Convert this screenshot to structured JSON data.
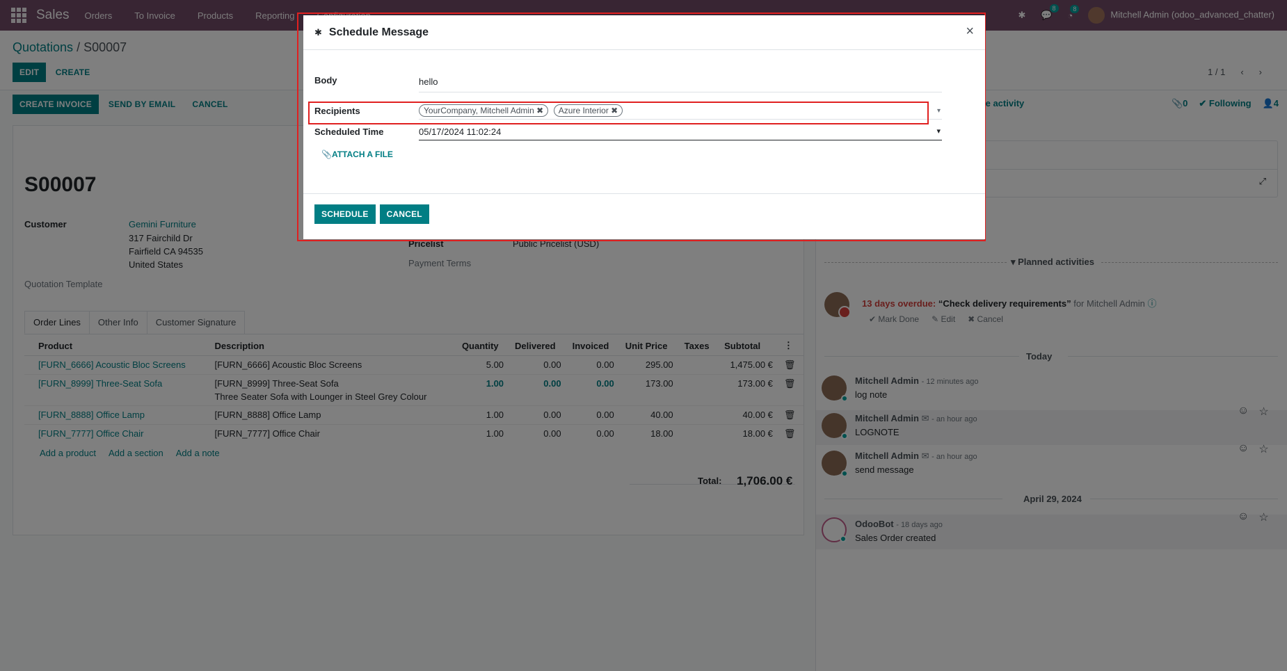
{
  "navbar": {
    "brand": "Sales",
    "menu": [
      "Orders",
      "To Invoice",
      "Products",
      "Reporting",
      "Configuration"
    ],
    "chat_count": "8",
    "activity_count": "8",
    "user": "Mitchell Admin (odoo_advanced_chatter)"
  },
  "breadcrumb": {
    "parent": "Quotations",
    "separator": " / ",
    "current": "S00007"
  },
  "buttons": {
    "edit": "EDIT",
    "create": "CREATE",
    "create_invoice": "CREATE INVOICE",
    "send_by_email": "SEND BY EMAIL",
    "cancel": "CANCEL"
  },
  "pager": {
    "value": "1 / 1"
  },
  "chatter_top": {
    "schedule_activity": "le activity",
    "attachments": "0",
    "following": "Following",
    "followers": "4"
  },
  "order": {
    "name": "S00007",
    "customer_label": "Customer",
    "customer": "Gemini Furniture",
    "address1": "317 Fairchild Dr",
    "address2": "Fairfield CA 94535",
    "address3": "United States",
    "template_label": "Quotation Template",
    "pricelist_label": "Pricelist",
    "pricelist": "Public Pricelist (USD)",
    "payment_terms_label": "Payment Terms"
  },
  "tabs": [
    "Order Lines",
    "Other Info",
    "Customer Signature"
  ],
  "lines": {
    "headers": [
      "Product",
      "Description",
      "Quantity",
      "Delivered",
      "Invoiced",
      "Unit Price",
      "Taxes",
      "Subtotal"
    ],
    "rows": [
      {
        "product": "[FURN_6666] Acoustic Bloc Screens",
        "description": "[FURN_6666] Acoustic Bloc Screens",
        "description2": "",
        "qty": "5.00",
        "delivered": "0.00",
        "invoiced": "0.00",
        "price": "295.00",
        "taxes": "",
        "subtotal": "1,475.00 €"
      },
      {
        "product": "[FURN_8999] Three-Seat Sofa",
        "description": "[FURN_8999] Three-Seat Sofa",
        "description2": "Three Seater Sofa with Lounger in Steel Grey Colour",
        "qty": "1.00",
        "delivered": "0.00",
        "invoiced": "0.00",
        "price": "173.00",
        "taxes": "",
        "subtotal": "173.00 €"
      },
      {
        "product": "[FURN_8888] Office Lamp",
        "description": "[FURN_8888] Office Lamp",
        "description2": "",
        "qty": "1.00",
        "delivered": "0.00",
        "invoiced": "0.00",
        "price": "40.00",
        "taxes": "",
        "subtotal": "40.00 €"
      },
      {
        "product": "[FURN_7777] Office Chair",
        "description": "[FURN_7777] Office Chair",
        "description2": "",
        "qty": "1.00",
        "delivered": "0.00",
        "invoiced": "0.00",
        "price": "18.00",
        "taxes": "",
        "subtotal": "18.00 €"
      }
    ],
    "add_product": "Add a product",
    "add_section": "Add a section",
    "add_note": "Add a note",
    "total_label": "Total:",
    "total": "1,706.00 €"
  },
  "chatter": {
    "planned_activities": "Planned activities",
    "activity_overdue": "13 days overdue:",
    "activity_summary": "“Check delivery requirements”",
    "activity_for": "for Mitchell Admin",
    "mark_done": "Mark Done",
    "edit": "Edit",
    "cancel": "Cancel",
    "today": "Today",
    "messages": [
      {
        "author": "Mitchell Admin",
        "time": "- 12 minutes ago",
        "body": "log note"
      },
      {
        "author": "Mitchell Admin",
        "time": "- an hour ago",
        "body": "LOGNOTE"
      },
      {
        "author": "Mitchell Admin",
        "time": "- an hour ago",
        "body": "send message"
      }
    ],
    "date2": "April 29, 2024",
    "bot": {
      "author": "OdooBot",
      "time": "- 18 days ago",
      "body": "Sales Order created"
    }
  },
  "modal": {
    "title": "Schedule Message",
    "body_label": "Body",
    "body_value": "hello",
    "recipients_label": "Recipients",
    "recipients": [
      "YourCompany, Mitchell Admin",
      "Azure Interior"
    ],
    "scheduled_label": "Scheduled Time",
    "scheduled_value": "05/17/2024 11:02:24",
    "attach": "ATTACH A FILE",
    "schedule_btn": "SCHEDULE",
    "cancel_btn": "CANCEL"
  }
}
